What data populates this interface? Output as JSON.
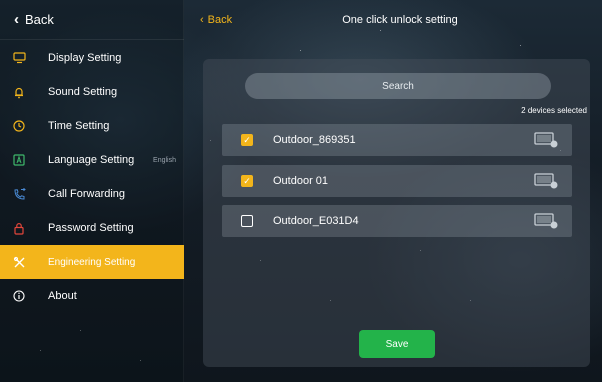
{
  "sidebar": {
    "back_label": "Back",
    "items": [
      {
        "label": "Display Setting",
        "icon": "monitor-icon",
        "extra": ""
      },
      {
        "label": "Sound Setting",
        "icon": "bell-icon",
        "extra": ""
      },
      {
        "label": "Time Setting",
        "icon": "clock-icon",
        "extra": ""
      },
      {
        "label": "Language Setting",
        "icon": "language-icon",
        "extra": "English"
      },
      {
        "label": "Call Forwarding",
        "icon": "call-forward-icon",
        "extra": ""
      },
      {
        "label": "Password Setting",
        "icon": "lock-icon",
        "extra": ""
      },
      {
        "label": "Engineering Setting",
        "icon": "tools-icon",
        "extra": ""
      },
      {
        "label": "About",
        "icon": "info-icon",
        "extra": ""
      }
    ],
    "active_index": 6
  },
  "header": {
    "back_label": "Back",
    "title": "One click unlock setting"
  },
  "main": {
    "search_placeholder": "Search",
    "selected_text": "2 devices selected",
    "devices": [
      {
        "name": "Outdoor_869351",
        "checked": true
      },
      {
        "name": "Outdoor 01",
        "checked": true
      },
      {
        "name": "Outdoor_E031D4",
        "checked": false
      }
    ],
    "save_label": "Save"
  },
  "colors": {
    "accent": "#f3b51b",
    "save": "#23b34a"
  }
}
